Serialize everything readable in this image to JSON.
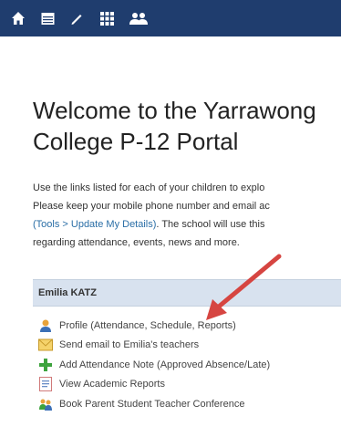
{
  "nav": {
    "icons": [
      "home-icon",
      "calendar-icon",
      "pencil-icon",
      "grid-icon",
      "users-icon"
    ],
    "color": "#1f3d6e"
  },
  "welcome": {
    "line1": "Welcome to the Yarrawong",
    "line2": "College P-12 Portal"
  },
  "intro": {
    "line1": "Use the links listed for each of your children to explo",
    "line2": "Please keep your mobile phone number and email ac",
    "line3_link": "(Tools > Update My Details)",
    "line3_rest": ". The school will use this",
    "line4": "regarding attendance, events, news and more."
  },
  "student": {
    "name": "Emilia KATZ"
  },
  "links": [
    {
      "label": "Profile (Attendance, Schedule, Reports)",
      "icon": "profile-icon"
    },
    {
      "label": "Send email to Emilia's teachers",
      "icon": "email-icon"
    },
    {
      "label": "Add Attendance Note (Approved Absence/Late)",
      "icon": "plus-icon"
    },
    {
      "label": "View Academic Reports",
      "icon": "report-icon"
    },
    {
      "label": "Book Parent Student Teacher Conference",
      "icon": "conference-icon"
    }
  ],
  "colors": {
    "accent_header": "#d8e2ef",
    "link_text": "#2a6ea6",
    "annotation_arrow": "#d64541"
  }
}
